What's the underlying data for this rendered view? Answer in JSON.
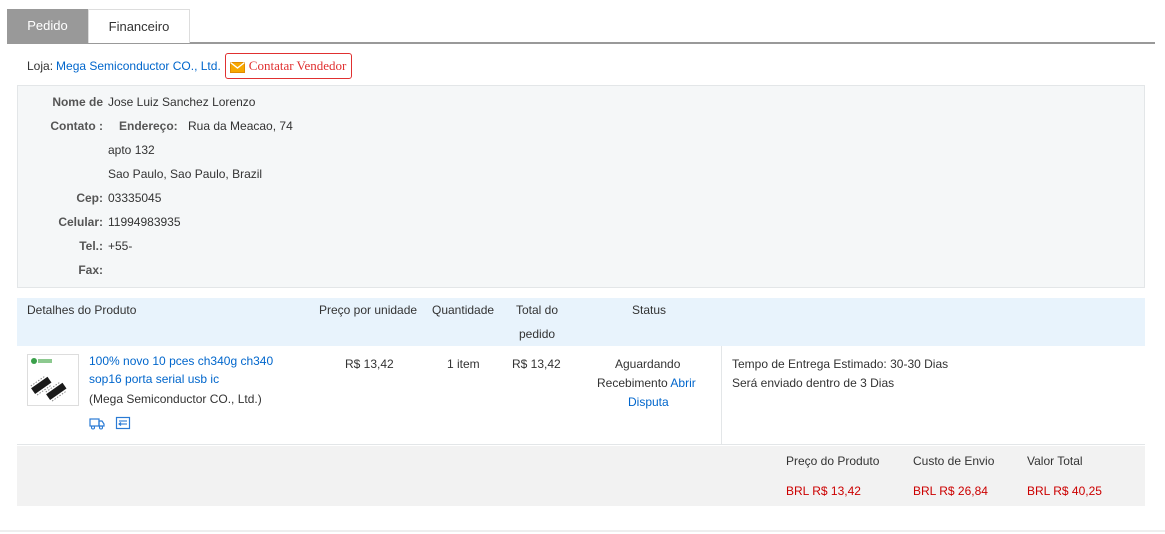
{
  "tabs": [
    {
      "label": "Pedido",
      "active": true
    },
    {
      "label": "Financeiro",
      "active": false
    }
  ],
  "store": {
    "label": "Loja:",
    "name": "Mega Semiconductor CO., Ltd.",
    "contact_button": "Contatar Vendedor"
  },
  "address": {
    "name_label": "Nome de",
    "contact_label": "Contato :",
    "name_value": "Jose Luiz Sanchez Lorenzo",
    "address_label": "Endereço:",
    "address_line1": "Rua da Meacao, 74",
    "address_line2": "apto 132",
    "address_line3": "Sao Paulo, Sao Paulo, Brazil",
    "cep_label": "Cep:",
    "cep_value": "03335045",
    "mobile_label": "Celular:",
    "mobile_value": "11994983935",
    "tel_label": "Tel.:",
    "tel_value": "+55-",
    "fax_label": "Fax:",
    "fax_value": ""
  },
  "table": {
    "col_details": "Detalhes do Produto",
    "col_unit_price": "Preço por unidade",
    "col_quantity": "Quantidade",
    "col_total_line1": "Total do",
    "col_total_line2": "pedido",
    "col_status": "Status"
  },
  "product": {
    "title": "100% novo 10 pces ch340g ch340 sop16 porta serial usb ic",
    "seller": "(Mega Semiconductor CO., Ltd.)",
    "unit_price": "R$ 13,42",
    "quantity": "1 item",
    "total": "R$ 13,42",
    "status_line1": "Aguardando",
    "status_line2": "Recebimento",
    "dispute_link_1": "Abrir",
    "dispute_link_2": "Disputa",
    "delivery_label": "Tempo de Entrega Estimado:",
    "delivery_value": "30-30 Dias",
    "ship_label": "Será enviado dentro de",
    "ship_value": "3 Dias"
  },
  "totals": {
    "product_price_label": "Preço do Produto",
    "shipping_label": "Custo de Envio",
    "total_label": "Valor Total",
    "product_price": "BRL R$ 13,42",
    "shipping": "BRL R$ 26,84",
    "total": "BRL R$ 40,25"
  },
  "colors": {
    "link": "#0066cc",
    "price_red": "#cc0000",
    "contact_red": "#e03030",
    "tab_active_bg": "#999999",
    "header_bg": "#e8f3fc"
  },
  "icons": [
    "mail-icon",
    "shipping-truck-icon",
    "snapshot-icon"
  ]
}
